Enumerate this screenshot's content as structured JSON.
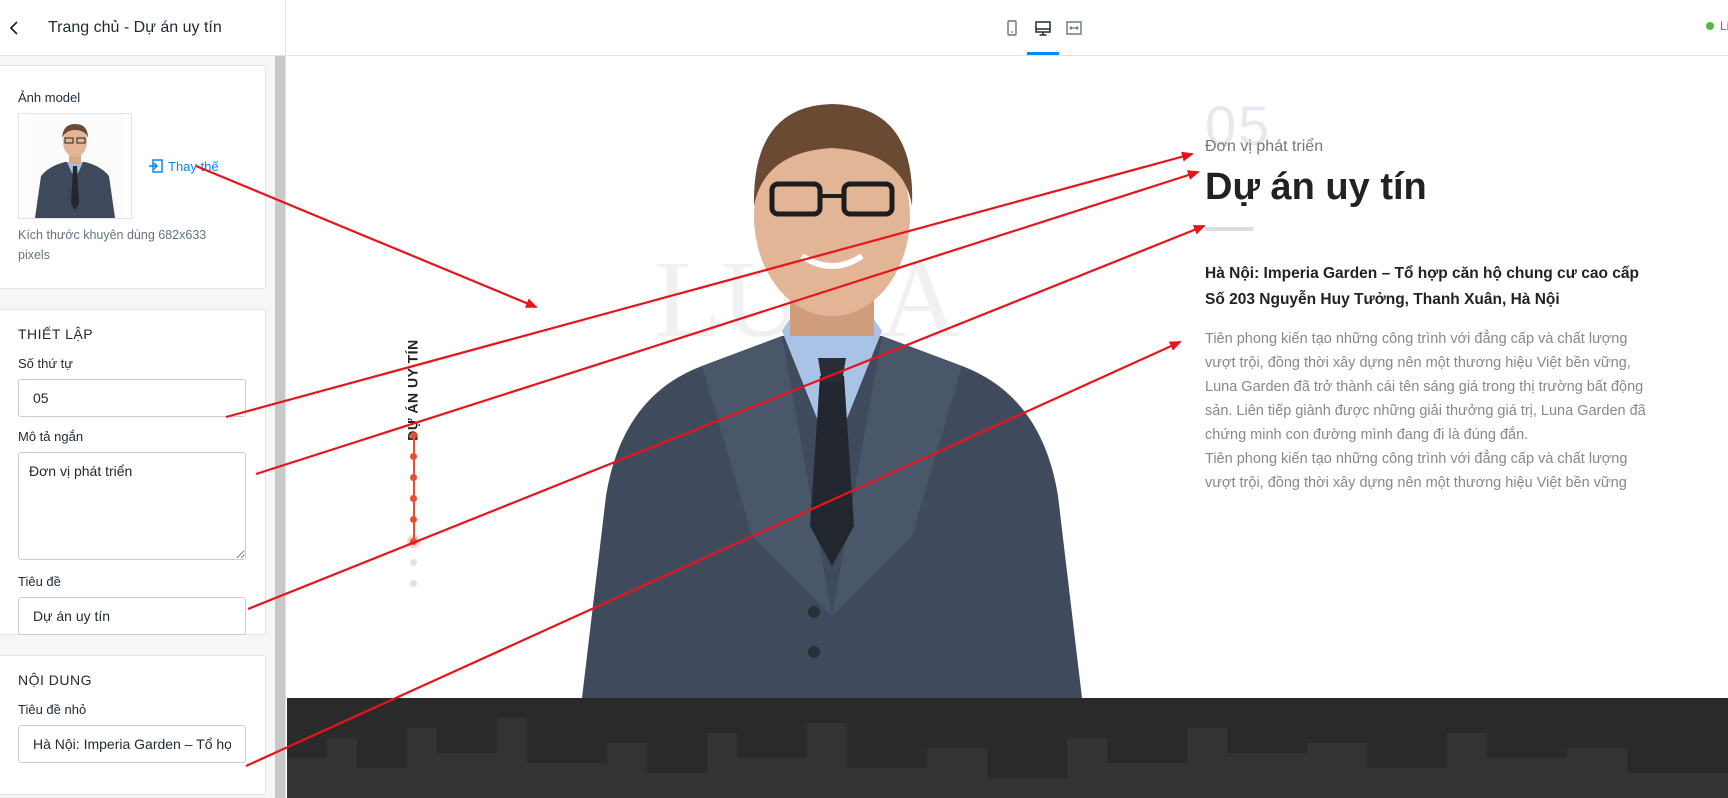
{
  "sidebar": {
    "title": "Trang chủ - Dự án uy tín",
    "image_field": {
      "label": "Ảnh model",
      "replace_label": "Thay thế",
      "help": "Kích thước khuyên dùng 682x633 pixels"
    },
    "settings": {
      "section_title": "THIẾT LẬP",
      "order_label": "Số thứ tự",
      "order_value": "05",
      "short_desc_label": "Mô tả ngắn",
      "short_desc_value": "Đơn vị phát triển",
      "title_label": "Tiêu đề",
      "title_value": "Dự án uy tín"
    },
    "content": {
      "section_title": "NỘI DUNG",
      "small_title_label": "Tiêu đề nhỏ",
      "small_title_value": "Hà Nội: Imperia Garden – Tổ hợp căn hộ chung cư cao cấp"
    }
  },
  "topbar": {
    "devices": [
      "mobile-icon",
      "desktop-icon",
      "fullwidth-icon"
    ],
    "active_device": "desktop-icon",
    "live_label": "Live"
  },
  "preview": {
    "vertical_label": "DỰ ÁN UY TÍN",
    "big_number": "05",
    "short_desc": "Đơn vị phát triển",
    "heading": "Dự án uy tín",
    "small_title_line1": "Hà Nội: Imperia Garden – Tổ hợp căn hộ chung cư cao cấp",
    "small_title_line2": "Số 203 Nguyễn Huy Tưởng, Thanh Xuân, Hà Nội",
    "paragraph1": "Tiên phong kiến tạo những công trình với đẳng cấp và chất lượng vượt trội, đồng thời xây dựng nên một thương hiệu Việt bền vững, Luna Garden đã trở thành cái tên sáng giá trong thị trường bất động sản. Liên tiếp giành được những giải thưởng giá trị, Luna Garden đã chứng minh con đường mình đang đi là đúng đắn.",
    "paragraph2": "Tiên phong kiến tạo những công trình với đẳng cấp và chất lượng vượt trội, đồng thời xây dựng nên một thương hiệu Việt bền vững",
    "watermark_text": "LUNA"
  },
  "colors": {
    "accent": "#0088ff",
    "dot_active": "#e6502e",
    "arrow": "#e8141b",
    "footer": "#2a2a2a"
  }
}
